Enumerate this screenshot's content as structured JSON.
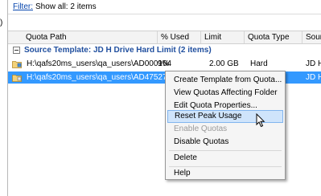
{
  "left_panel": {
    "stub_text": ")"
  },
  "filter_bar": {
    "link": "Filter:",
    "text": "Show all: 2 items"
  },
  "columns": [
    "Quota Path",
    "% Used",
    "Limit",
    "Quota Type",
    "Sour"
  ],
  "group": {
    "label": "Source Template: JD H Drive Hard Limit (2 items)"
  },
  "rows": [
    {
      "path": "H:\\qafs20ms_users\\qa_users\\AD000164",
      "used": "9%",
      "limit": "2.00 GB",
      "type": "Hard",
      "source": "JD H"
    },
    {
      "path": "H:\\qafs20ms_users\\qa_users\\AD475276",
      "used": "",
      "limit": "",
      "type": "",
      "source": "JD H"
    }
  ],
  "context_menu": {
    "items": [
      {
        "label": "Create Template from Quota...",
        "state": "normal"
      },
      {
        "label": "View Quotas Affecting Folder",
        "state": "normal"
      },
      {
        "label": "Edit Quota Properties...",
        "state": "normal"
      },
      {
        "label": "Reset Peak Usage",
        "state": "hover"
      },
      {
        "label": "Enable Quotas",
        "state": "disabled"
      },
      {
        "label": "Disable Quotas",
        "state": "normal"
      },
      {
        "label": "Delete",
        "state": "normal"
      },
      {
        "label": "Help",
        "state": "normal"
      }
    ]
  },
  "colors": {
    "selection": "#3399ff",
    "group_text": "#1f4e9e",
    "menu_hover": "#cfe4fb",
    "link": "#0645ad"
  },
  "icons": {
    "quota_row": "folder-quota-icon",
    "cursor": "mouse-pointer-icon"
  }
}
